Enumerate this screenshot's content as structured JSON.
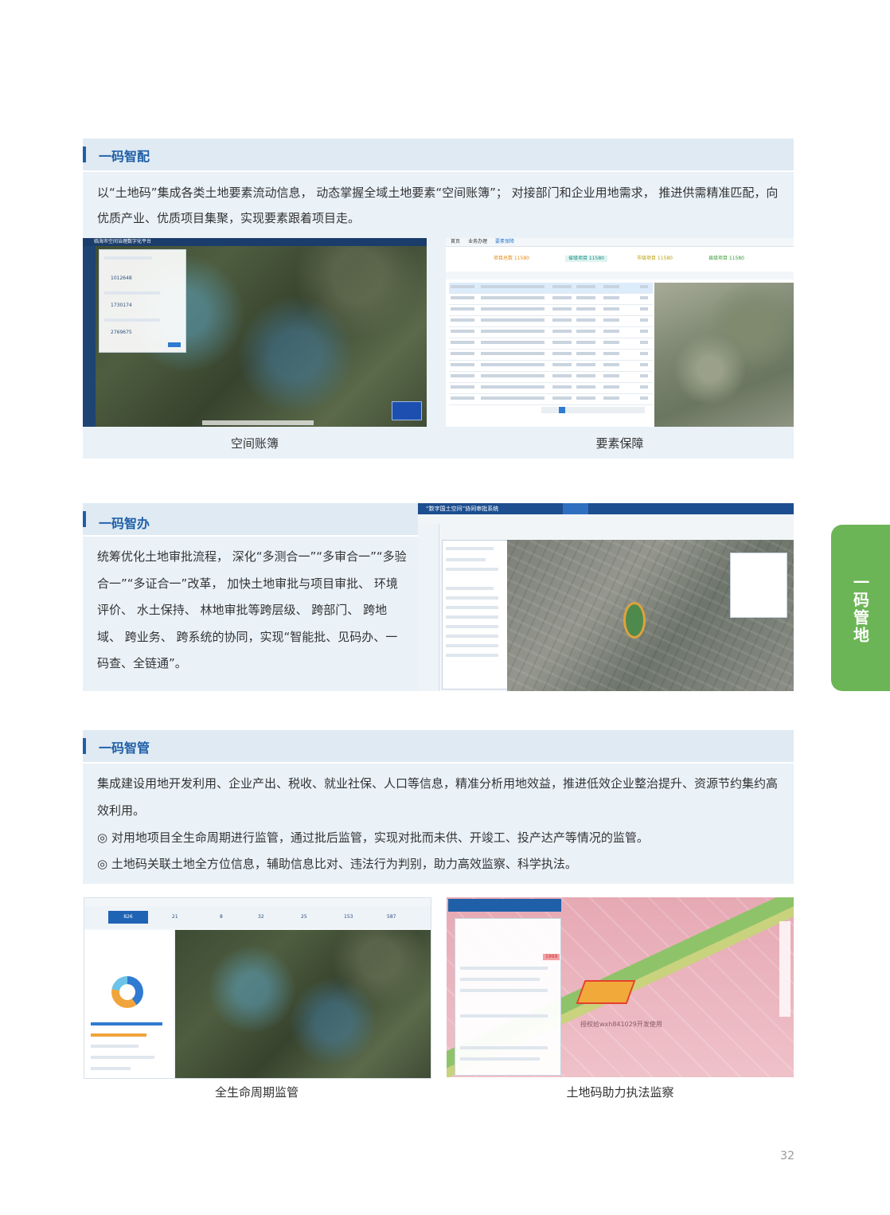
{
  "section1": {
    "title": "一码智配",
    "text": "以“土地码”集成各类土地要素流动信息， 动态掌握全域土地要素“空间账簿”； 对接部门和企业用地需求， 推进供需精准匹配，向优质产业、优质项目集聚，实现要素跟着项目走。",
    "captions": [
      "空间账簿",
      "要素保障"
    ]
  },
  "section2": {
    "title": "一码智办",
    "text": "统筹优化土地审批流程， 深化“多测合一”“多审合一”“多验合一”“多证合一”改革， 加快土地审批与项目审批、 环境评价、 水土保持、 林地审批等跨层级、 跨部门、 跨地域、 跨业务、 跨系统的协同，实现“智能批、见码办、一码查、全链通”。",
    "screen_title": "“数字国土空间”协同审批系统"
  },
  "section3": {
    "title": "一码智管",
    "lines": [
      "集成建设用地开发利用、企业产出、税收、就业社保、人口等信息，精准分析用地效益，推进低效企业整治提升、资源节约集约高效利用。",
      "◎ 对用地项目全生命周期进行监管，通过批后监管，实现对批而未供、开竣工、投产达产等情况的监管。",
      "◎ 土地码关联土地全方位信息，辅助信息比对、违法行为判别，助力高效监察、科学执法。"
    ],
    "captions": [
      "全生命周期监管",
      "土地码助力执法监察"
    ]
  },
  "thumb_a": {
    "screen_title": "临海市空间治理数字化平台",
    "values": [
      "1012648",
      "1730174",
      "2769675"
    ]
  },
  "thumb_b": {
    "tabs": [
      "首页",
      "业务办理",
      "要素保障"
    ],
    "stats": [
      "项目总数 11580",
      "省级项目 11580",
      "市级项目 11580",
      "县级项目 11580"
    ]
  },
  "thumb_c": {
    "stats": [
      "826",
      "21",
      "8",
      "32",
      "25",
      "153",
      "587"
    ]
  },
  "thumb_d": {
    "watermark": "授权给wxh841029开发使用",
    "badge": "1999"
  },
  "side_tab": {
    "label": "一码管地"
  },
  "page_number": "32",
  "colors": {
    "accent": "#1f5fa8",
    "section_bg": "#eaf2f8",
    "tab_green": "#6cb556"
  }
}
